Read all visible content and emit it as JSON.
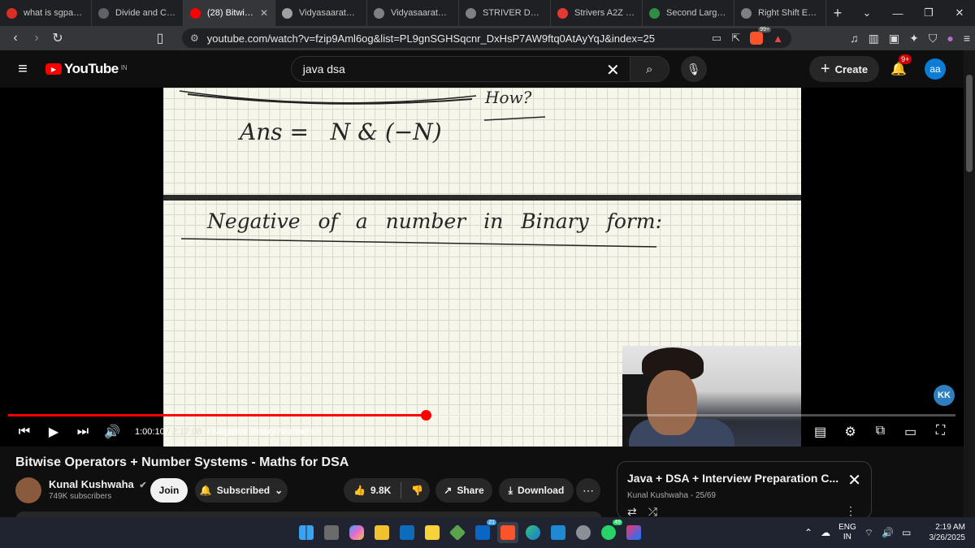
{
  "browser": {
    "tabs": [
      {
        "title": "what is sgpa and c",
        "color": "#d93025"
      },
      {
        "title": "Divide and Conqu",
        "color": "#5f6368"
      },
      {
        "title": "(28) Bitwise O",
        "color": "#ff0000",
        "active": true
      },
      {
        "title": "Vidyasaarathi | Ap",
        "color": "#a0a0a0"
      },
      {
        "title": "Vidyasaarathi- Sc",
        "color": "#808080"
      },
      {
        "title": "STRIVER DSA SHE",
        "color": "#808080"
      },
      {
        "title": "Strivers A2Z DSA",
        "color": "#e53935"
      },
      {
        "title": "Second Largest | E",
        "color": "#2f8d46"
      },
      {
        "title": "Right Shift Explan",
        "color": "#808080"
      }
    ],
    "url": "youtube.com/watch?v=fzip9Aml6og&list=PL9gnSGHSqcnr_DxHsP7AW9ftq0AtAyYqJ&index=25",
    "brave_badge": "99+"
  },
  "youtube": {
    "logo": "YouTube",
    "country": "IN",
    "search_value": "java dsa",
    "create_label": "Create",
    "notif_count": "9+",
    "avatar": "aa"
  },
  "video": {
    "board": {
      "ans_line": "Ans =   N & (−N)",
      "how": "How?",
      "heading": "Negative of a number in Binary form:"
    },
    "channel_badge": "KK",
    "progress": 0.4406,
    "current_time": "1:00:10",
    "duration": "2:17:08",
    "chapter": "Negative Binary Numbers"
  },
  "info": {
    "title": "Bitwise Operators + Number Systems - Maths for DSA",
    "channel": "Kunal Kushwaha",
    "subscribers": "749K subscribers",
    "join": "Join",
    "subscribed": "Subscribed",
    "likes": "9.8K",
    "share": "Share",
    "download": "Download"
  },
  "playlist": {
    "title": "Java + DSA + Interview Preparation C...",
    "sub": "Kunal Kushwaha - 25/69"
  },
  "taskbar": {
    "badges": {
      "linkedin": "21",
      "whatsapp": "49"
    },
    "lang1": "ENG",
    "lang2": "IN",
    "time": "2:19 AM",
    "date": "3/26/2025"
  },
  "colors": {
    "accent": "#ff0000",
    "avatar": "#0b7dd6"
  }
}
